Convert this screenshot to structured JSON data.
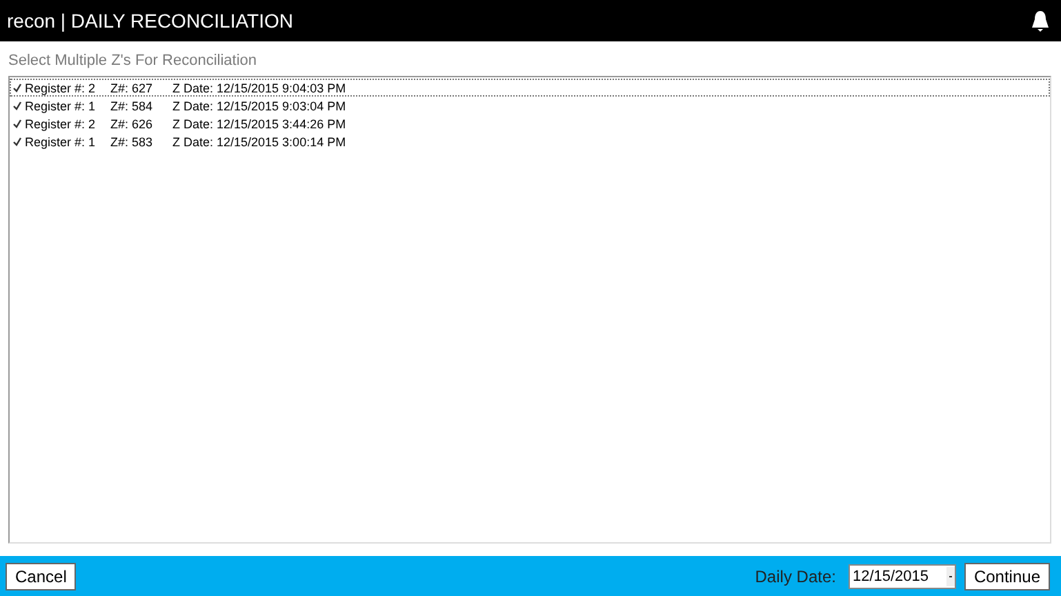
{
  "window": {
    "title": "recon | DAILY RECONCILIATION"
  },
  "prompt": "Select Multiple Z's For Reconciliation",
  "items": [
    {
      "register": "Register #: 2",
      "z_number": "Z#: 627",
      "z_date": "Z Date: 12/15/2015 9:04:03 PM",
      "checked": true,
      "selected": true
    },
    {
      "register": "Register #: 1",
      "z_number": "Z#: 584",
      "z_date": "Z Date: 12/15/2015 9:03:04 PM",
      "checked": true,
      "selected": false
    },
    {
      "register": "Register #: 2",
      "z_number": "Z#: 626",
      "z_date": "Z Date: 12/15/2015 3:44:26 PM",
      "checked": true,
      "selected": false
    },
    {
      "register": "Register #: 1",
      "z_number": "Z#: 583",
      "z_date": "Z Date: 12/15/2015 3:00:14 PM",
      "checked": true,
      "selected": false
    }
  ],
  "footer": {
    "cancel": "Cancel",
    "date_label": "Daily Date:",
    "date_value": "12/15/2015",
    "continue": "Continue"
  }
}
